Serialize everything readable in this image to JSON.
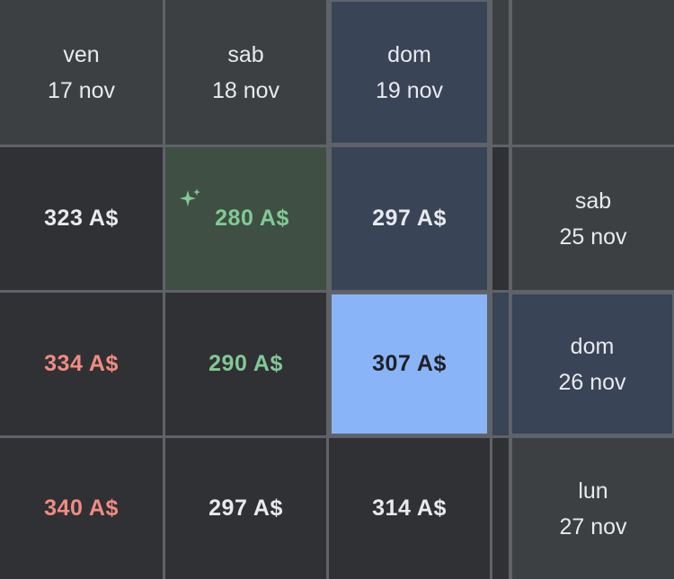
{
  "columns": [
    {
      "day": "ven",
      "date": "17 nov"
    },
    {
      "day": "sab",
      "date": "18 nov"
    },
    {
      "day": "dom",
      "date": "19 nov"
    }
  ],
  "rows": [
    {
      "day": "sab",
      "date": "25 nov",
      "prices": [
        "323 A$",
        "280 A$",
        "297 A$"
      ]
    },
    {
      "day": "dom",
      "date": "26 nov",
      "prices": [
        "334 A$",
        "290 A$",
        "307 A$"
      ]
    },
    {
      "day": "lun",
      "date": "27 nov",
      "prices": [
        "340 A$",
        "297 A$",
        "314 A$"
      ]
    }
  ],
  "colors": {
    "cheap": "#81c995",
    "expensive": "#f28b82",
    "selected": "#8ab4f8",
    "selected_axis": "#394457"
  },
  "selection": {
    "column": "dom 19 nov",
    "row": "dom 26 nov",
    "price": "307 A$"
  },
  "lowest_marker_icon": "sparkle-icon"
}
